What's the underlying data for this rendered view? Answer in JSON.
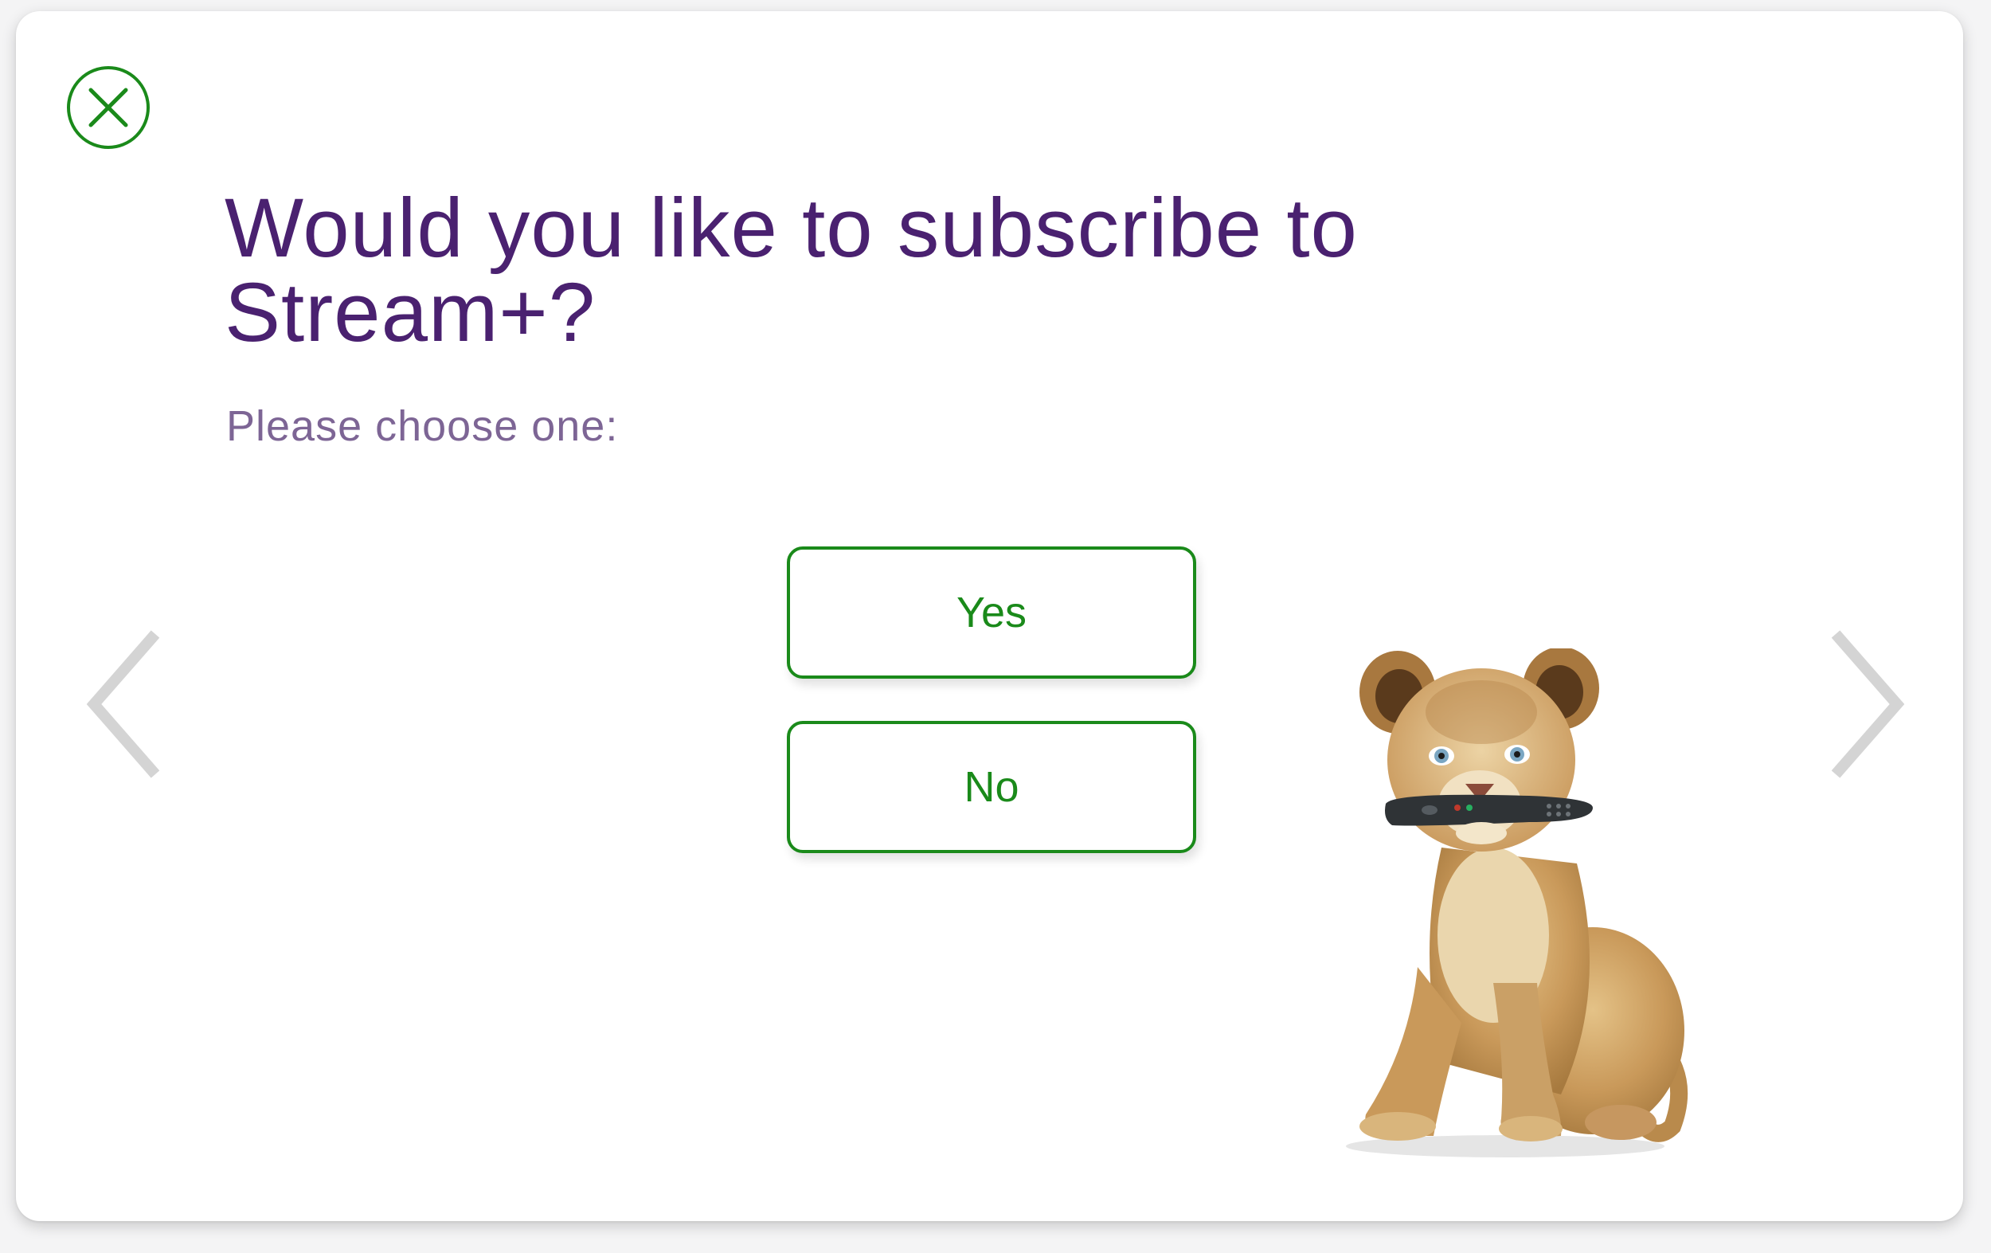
{
  "dialog": {
    "title": "Would you like to subscribe to Stream+?",
    "subtitle": "Please choose one:",
    "options": {
      "yes_label": "Yes",
      "no_label": "No"
    }
  },
  "icons": {
    "close": "close-icon",
    "prev": "chevron-left-icon",
    "next": "chevron-right-icon"
  },
  "colors": {
    "title": "#4a2170",
    "subtitle": "#7d6595",
    "accent_green": "#1a8a1a",
    "arrow_gray": "#d4d4d4",
    "background": "#ffffff"
  }
}
